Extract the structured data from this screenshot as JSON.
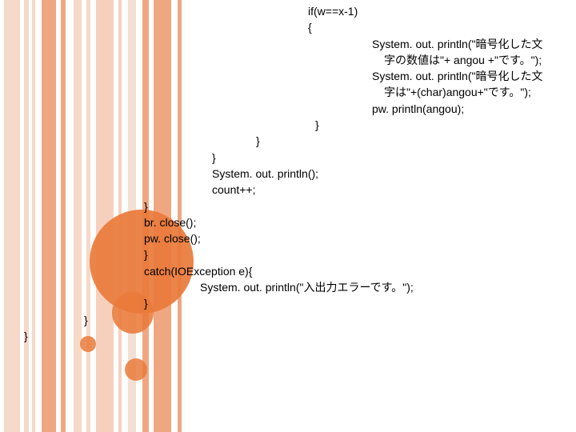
{
  "code": {
    "l1": "if(w==x-1)",
    "l2": "{",
    "l3": "System. out. println(\"暗号化した文",
    "l4": "字の数値は\"+ angou +\"です。\");",
    "l5": "System. out. println(\"暗号化した文",
    "l6": "字は\"+(char)angou+\"です。\");",
    "l7": "pw. println(angou);",
    "l8": "}",
    "l9": "}",
    "l10": "}",
    "l11": "System. out. println();",
    "l12": "count++;",
    "l13": "}",
    "l14": "br. close();",
    "l15": "pw. close();",
    "l16": "}",
    "l17": "catch(IOException e){",
    "l18": "System. out. println(\"入出力エラーです。\");",
    "l19": "}",
    "l20": "}",
    "l21": "}"
  }
}
